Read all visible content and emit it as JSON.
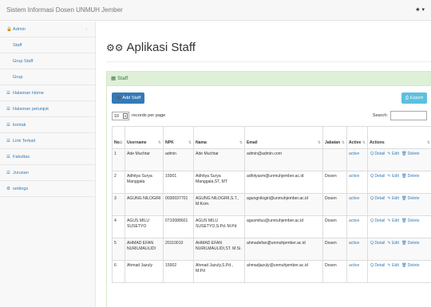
{
  "app": {
    "brand": "Sistem Informasi Dosen UNMUH Jember",
    "user_icon_glyph": "★ ▾"
  },
  "sidebar": {
    "items": [
      {
        "label": "Admin",
        "icon": "lock-icon",
        "glyph": "🔒",
        "caret": "‹"
      },
      {
        "label": "Staff"
      },
      {
        "label": "Grup Staff"
      },
      {
        "label": "Grup"
      },
      {
        "label": "Halaman Home",
        "icon": "list-icon",
        "glyph": "☰"
      },
      {
        "label": "Halaman petunjuk",
        "icon": "list-icon",
        "glyph": "☰"
      },
      {
        "label": "kontak",
        "icon": "list-icon",
        "glyph": "☰"
      },
      {
        "label": "Link Terkait",
        "icon": "list-icon",
        "glyph": "☰"
      },
      {
        "label": "Fakultas",
        "icon": "list-icon",
        "glyph": "☰"
      },
      {
        "label": "Jurusan",
        "icon": "list-icon",
        "glyph": "☰"
      },
      {
        "label": "settings",
        "icon": "gear-icon",
        "glyph": "⚙"
      }
    ]
  },
  "page": {
    "title": "Aplikasi Staff",
    "title_icon_glyph": "⚙⚙"
  },
  "panel": {
    "heading": "Staff",
    "heading_icon_glyph": "▦",
    "add_label": "Add Staff",
    "add_icon_glyph": "➕",
    "export_label": "Export",
    "export_icon_glyph": "⎙",
    "length_value": "10",
    "length_dropdown_glyph": "▾",
    "length_suffix": "records per page",
    "search_label": "Search:",
    "search_value": ""
  },
  "table": {
    "sort_glyph": "⇅",
    "headers": [
      "No.",
      "Username",
      "NPK",
      "Nama",
      "Email",
      "Jabatan",
      "Active",
      "Actions"
    ],
    "action_labels": {
      "detail": "Q Detail",
      "edit": "✎ Edit",
      "delete": "🗑 Delete"
    },
    "rows": [
      {
        "no": "1",
        "username": "Ade Muchtar",
        "npk": "admin",
        "nama": "Ade Muchtar",
        "email": "admin@admin.com",
        "jabatan": "",
        "active": "active"
      },
      {
        "no": "2",
        "username": "Adhitya Surya Manggala",
        "npk": "15001",
        "nama": "Adhitya Surya Manggala,ST, MT",
        "email": "adhityasm@unmuhjember.ac.id",
        "jabatan": "Dosen",
        "active": "active"
      },
      {
        "no": "3",
        "username": "AGUNG NILOGIRI",
        "npk": "0030037701",
        "nama": "AGUNG NILOGIRI,S.T., M.Kom.",
        "email": "agungnilogiri@unmuhjember.ac.id",
        "jabatan": "Dosen",
        "active": "active"
      },
      {
        "no": "4",
        "username": "AGUS MILU SUSETYO",
        "npk": "0710088601",
        "nama": "AGUS MILU SUSETYO,S.Pd. M.Pd",
        "email": "agusmilus@unmuhjember.ac.id",
        "jabatan": "Dosen",
        "active": "active"
      },
      {
        "no": "5",
        "username": "AHMAD EFAN NURILMAULIDI",
        "npk": "20110010",
        "nama": "AHMAD EFAN NURILMAULIDI,ST. M.Si.",
        "email": "ahmadefan@unmuhjember.ac.id",
        "jabatan": "Dosen",
        "active": "active"
      },
      {
        "no": "6",
        "username": "Ahmad Jazuly",
        "npk": "15002",
        "nama": "Ahmad Jazuly,S.Pd., M.Pd",
        "email": "ahmadjazuly@unmuhjember.ac.id",
        "jabatan": "Dosen",
        "active": "active"
      }
    ]
  }
}
